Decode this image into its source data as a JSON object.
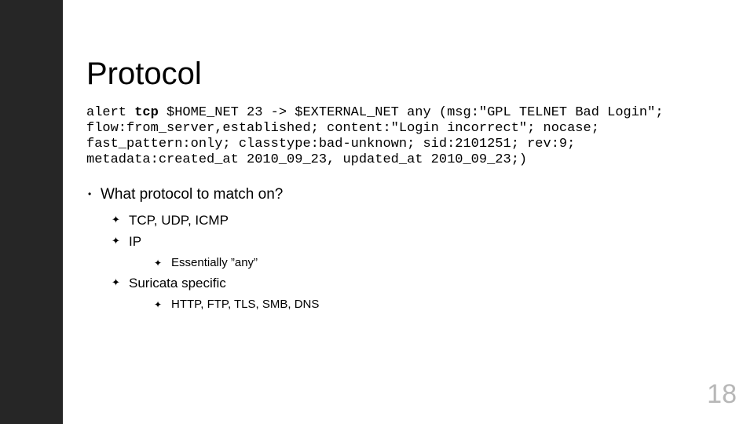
{
  "slide": {
    "title": "Protocol",
    "code_pre": "alert ",
    "code_bold": "tcp",
    "code_post": " $HOME_NET 23 -> $EXTERNAL_NET any (msg:\"GPL TELNET Bad Login\"; flow:from_server,established; content:\"Login incorrect\"; nocase; fast_pattern:only; classtype:bad-unknown; sid:2101251; rev:9; metadata:created_at 2010_09_23, updated_at 2010_09_23;)",
    "bullet1": "What protocol to match on?",
    "sub1": "TCP, UDP, ICMP",
    "sub2": "IP",
    "subsub1": "Essentially ”any”",
    "sub3": "Suricata specific",
    "subsub2": "HTTP, FTP, TLS, SMB, DNS",
    "page_number": "18"
  }
}
